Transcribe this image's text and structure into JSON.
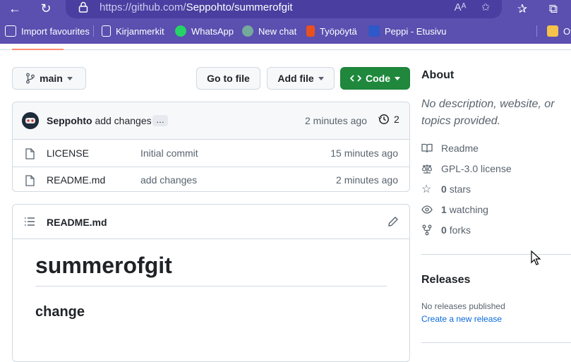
{
  "browser": {
    "url_host": "https://github.com/",
    "url_path": "Seppohto/summerofgit",
    "favorites": [
      {
        "label": "Import favourites",
        "color": "#3a2f85"
      },
      {
        "label": "Kirjanmerkit",
        "color": "#ffffff"
      },
      {
        "label": "WhatsApp",
        "color": "#25d366"
      },
      {
        "label": "New chat",
        "color": "#74aa9c"
      },
      {
        "label": "Työpöytä",
        "color": "#e8501f"
      },
      {
        "label": "Peppi - Etusivu",
        "color": "#2f58c8"
      },
      {
        "label": "Ot",
        "color": "#f5c24b"
      }
    ]
  },
  "repo": {
    "branch": "main",
    "go_to_file": "Go to file",
    "add_file": "Add file",
    "code": "Code",
    "commit": {
      "author": "Seppohto",
      "message": "add changes",
      "ellipsis": "…",
      "time": "2 minutes ago",
      "count": "2"
    },
    "files": [
      {
        "name": "LICENSE",
        "message": "Initial commit",
        "time": "15 minutes ago"
      },
      {
        "name": "README.md",
        "message": "add changes",
        "time": "2 minutes ago"
      }
    ],
    "readme": {
      "filename": "README.md",
      "h1": "summerofgit",
      "h2": "change"
    }
  },
  "about": {
    "title": "About",
    "description": "No description, website, or topics provided.",
    "readme_label": "Readme",
    "license": "GPL-3.0 license",
    "stars_count": "0",
    "stars_label": "stars",
    "watching_count": "1",
    "watching_label": "watching",
    "forks_count": "0",
    "forks_label": "forks"
  },
  "releases": {
    "title": "Releases",
    "none": "No releases published",
    "create_link": "Create a new release"
  },
  "colors": {
    "brand_bar": "#5b4fb0",
    "code_button": "#1f883d",
    "link": "#0969da"
  }
}
